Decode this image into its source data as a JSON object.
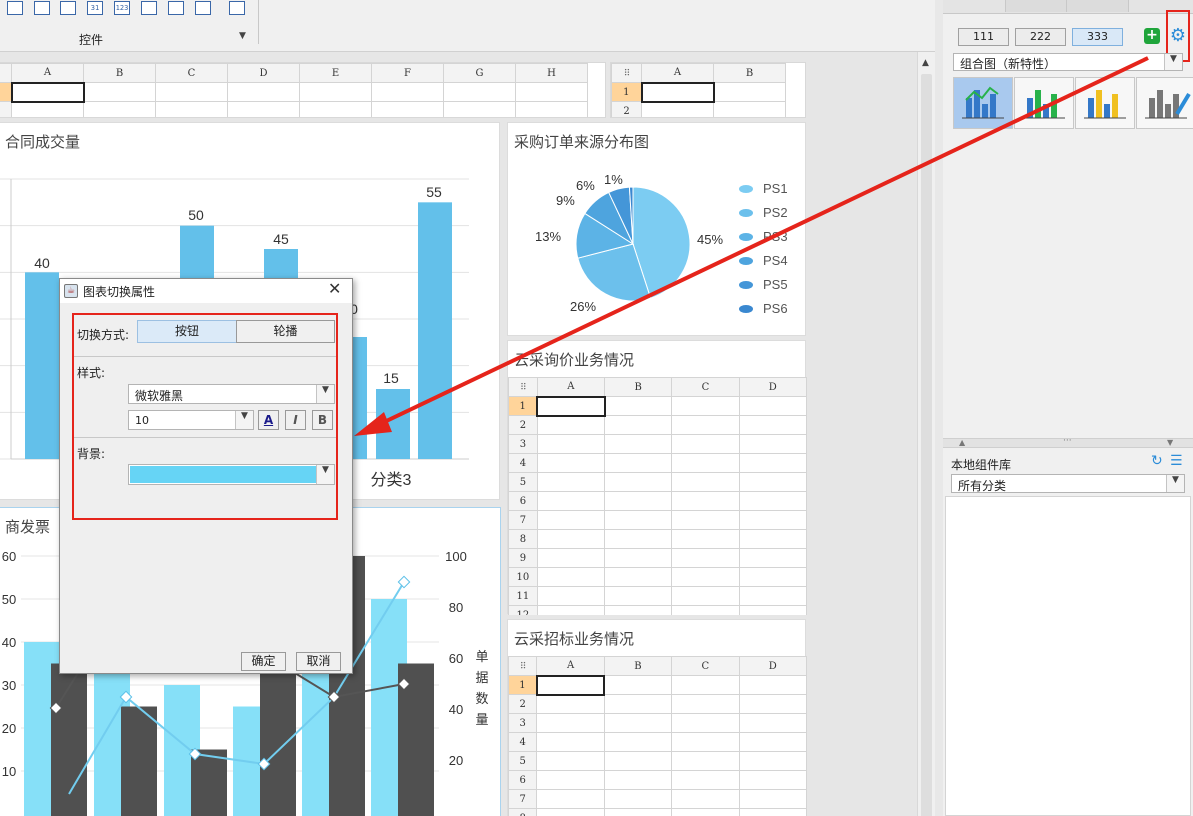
{
  "toolbar": {
    "group_label": "控件",
    "icons": [
      "button-icon",
      "combo-icon",
      "checkbox-icon",
      "date-icon",
      "number-icon",
      "table-icon",
      "radio-list-icon",
      "checkbox-list-icon",
      "search-icon"
    ],
    "icon_glyphs": [
      "",
      "",
      "",
      "31",
      "123",
      "",
      "",
      "",
      ""
    ]
  },
  "sheets": {
    "cols_main": [
      "A",
      "B",
      "C",
      "D",
      "E",
      "F",
      "G",
      "H"
    ],
    "cols_small": [
      "A",
      "B"
    ],
    "cols_four": [
      "A",
      "B",
      "C",
      "D"
    ],
    "rows_two": [
      "1",
      "2"
    ],
    "rows_twelve": [
      "1",
      "2",
      "3",
      "4",
      "5",
      "6",
      "7",
      "8",
      "9",
      "10",
      "11",
      "12"
    ],
    "rows_eight": [
      "1",
      "2",
      "3",
      "4",
      "5",
      "6",
      "7",
      "8"
    ]
  },
  "panels": {
    "bar_chart_title": "合同成交量",
    "pie_chart_title": "采购订单来源分布图",
    "inquiry_title": "云采询价业务情况",
    "bid_title": "云采招标业务情况",
    "combo_chart_title": "商发票"
  },
  "dialog": {
    "title": "图表切换属性",
    "switch_mode_label": "切换方式:",
    "mode_button": "按钮",
    "mode_carousel": "轮播",
    "style_label": "样式:",
    "font_family": "微软雅黑",
    "font_size": "10",
    "bold": "B",
    "italic": "I",
    "text_color": "A",
    "background_label": "背景:",
    "background_color": "#66d4f5",
    "ok": "确定",
    "cancel": "取消"
  },
  "right_panel": {
    "chart_type_buttons": [
      "111",
      "222",
      "333"
    ],
    "chart_type_select": "组合图（新特性）",
    "chart_variants": [
      "combo-line-bar-icon",
      "stacked-bar-icon",
      "multi-color-bar-icon",
      "bar-edit-icon"
    ],
    "library_title": "本地组件库",
    "library_category": "所有分类"
  },
  "colors": {
    "highlight": "#e5241b",
    "bar_blue": "#63c0ea",
    "pie_blue": "#6bc8f0",
    "dark_bar": "#505050",
    "light_bar": "#86e0f8"
  },
  "chart_data": [
    {
      "type": "bar",
      "title": "合同成交量",
      "categories": [
        "",
        "",
        "",
        "",
        "",
        "",
        "分类3",
        ""
      ],
      "values": [
        40,
        null,
        50,
        45,
        null,
        null,
        15,
        55
      ],
      "data_labels": [
        "40",
        "50",
        "45",
        "0",
        "15",
        "55",
        "分类3"
      ]
    },
    {
      "type": "pie",
      "title": "采购订单来源分布图",
      "labels": [
        "PS1",
        "PS2",
        "PS3",
        "PS4",
        "PS5",
        "PS6"
      ],
      "values": [
        45,
        26,
        13,
        9,
        6,
        1
      ],
      "label_texts": [
        "45%",
        "26%",
        "13%",
        "9%",
        "6%",
        "1%"
      ]
    },
    {
      "type": "bar",
      "title": "商发票",
      "y_left_ticks": [
        "60",
        "50",
        "40",
        "30",
        "20",
        "10"
      ],
      "y_right_ticks": [
        "100",
        "80",
        "60",
        "40",
        "20"
      ],
      "y_right_label": "单据数量",
      "series": [
        {
          "values": [
            40,
            45,
            30,
            25,
            35,
            50
          ]
        },
        {
          "values": [
            35,
            25,
            15,
            40,
            60,
            35
          ]
        }
      ],
      "lines": [
        {
          "values": [
            22,
            null,
            52,
            55,
            40,
            45
          ]
        },
        {
          "values": [
            2,
            40,
            8,
            3,
            45,
            85
          ]
        }
      ]
    }
  ]
}
